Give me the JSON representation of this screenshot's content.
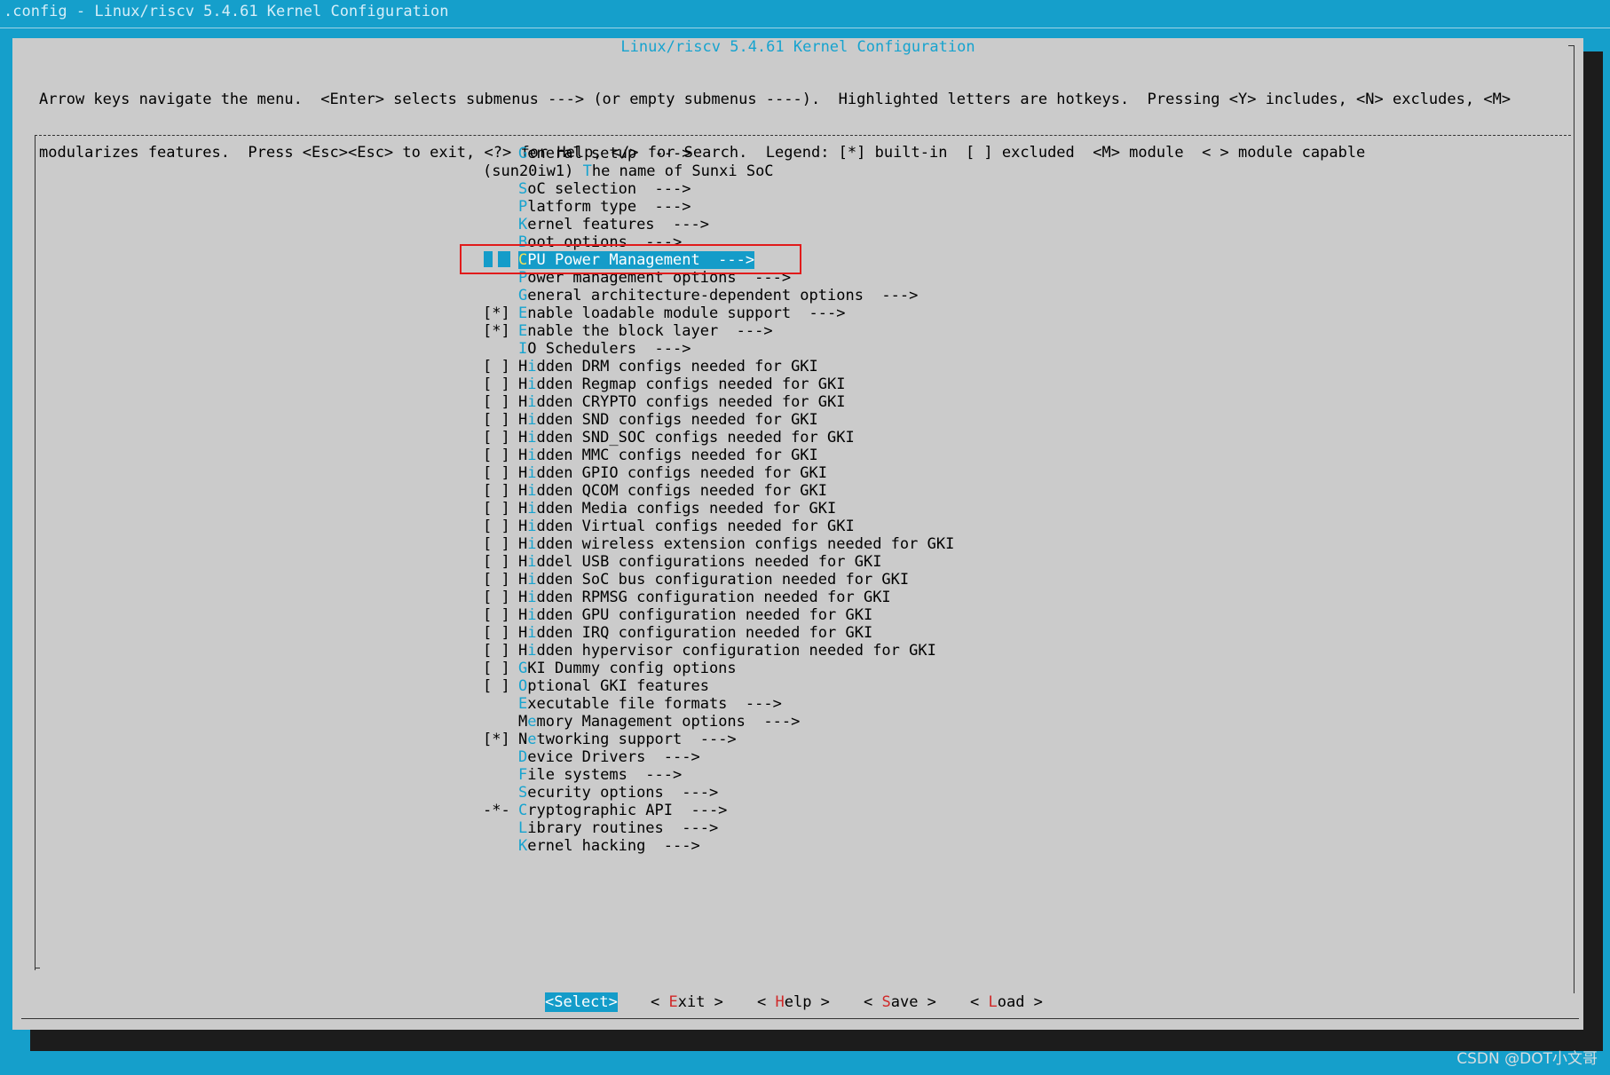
{
  "window": {
    "title": ".config - Linux/riscv 5.4.61 Kernel Configuration"
  },
  "dialog": {
    "title": "Linux/riscv 5.4.61 Kernel Configuration",
    "help_line1": "Arrow keys navigate the menu.  <Enter> selects submenus ---> (or empty submenus ----).  Highlighted letters are hotkeys.  Pressing <Y> includes, <N> excludes, <M>",
    "help_line2": "modularizes features.  Press <Esc><Esc> to exit, <?> for Help, </> for Search.  Legend: [*] built-in  [ ] excluded  <M> module  < > module capable"
  },
  "menu": {
    "selected_index": 6,
    "items": [
      {
        "prefix": "",
        "hotkey": "G",
        "rest": "eneral setup  --->"
      },
      {
        "prefix": "(sun20iw1) ",
        "hotkey": "T",
        "rest": "he name of Sunxi SoC",
        "inline": true
      },
      {
        "prefix": "",
        "hotkey": "S",
        "rest": "oC selection  --->"
      },
      {
        "prefix": "",
        "hotkey": "P",
        "rest": "latform type  --->"
      },
      {
        "prefix": "",
        "hotkey": "K",
        "rest": "ernel features  --->"
      },
      {
        "prefix": "",
        "hotkey": "B",
        "rest": "oot options  --->"
      },
      {
        "prefix": "",
        "hotkey": "C",
        "rest": "PU Power Management  --->"
      },
      {
        "prefix": "",
        "hotkey": "P",
        "rest": "ower management options  --->"
      },
      {
        "prefix": "",
        "hotkey": "G",
        "rest": "eneral architecture-dependent options  --->"
      },
      {
        "prefix": "[*]",
        "hotkey": "E",
        "rest": "nable loadable module support  --->"
      },
      {
        "prefix": "[*]",
        "hotkey": "E",
        "rest": "nable the block layer  --->"
      },
      {
        "prefix": "",
        "hotkey": "I",
        "rest": "O Schedulers  --->"
      },
      {
        "prefix": "[ ]",
        "lead": "H",
        "hotkey": "i",
        "rest": "dden DRM configs needed for GKI"
      },
      {
        "prefix": "[ ]",
        "lead": "H",
        "hotkey": "i",
        "rest": "dden Regmap configs needed for GKI"
      },
      {
        "prefix": "[ ]",
        "lead": "H",
        "hotkey": "i",
        "rest": "dden CRYPTO configs needed for GKI"
      },
      {
        "prefix": "[ ]",
        "lead": "H",
        "hotkey": "i",
        "rest": "dden SND configs needed for GKI"
      },
      {
        "prefix": "[ ]",
        "lead": "H",
        "hotkey": "i",
        "rest": "dden SND_SOC configs needed for GKI"
      },
      {
        "prefix": "[ ]",
        "lead": "H",
        "hotkey": "i",
        "rest": "dden MMC configs needed for GKI"
      },
      {
        "prefix": "[ ]",
        "lead": "H",
        "hotkey": "i",
        "rest": "dden GPIO configs needed for GKI"
      },
      {
        "prefix": "[ ]",
        "lead": "H",
        "hotkey": "i",
        "rest": "dden QCOM configs needed for GKI"
      },
      {
        "prefix": "[ ]",
        "lead": "H",
        "hotkey": "i",
        "rest": "dden Media configs needed for GKI"
      },
      {
        "prefix": "[ ]",
        "lead": "H",
        "hotkey": "i",
        "rest": "dden Virtual configs needed for GKI"
      },
      {
        "prefix": "[ ]",
        "lead": "H",
        "hotkey": "i",
        "rest": "dden wireless extension configs needed for GKI"
      },
      {
        "prefix": "[ ]",
        "lead": "H",
        "hotkey": "i",
        "rest": "ddel USB configurations needed for GKI"
      },
      {
        "prefix": "[ ]",
        "lead": "H",
        "hotkey": "i",
        "rest": "dden SoC bus configuration needed for GKI"
      },
      {
        "prefix": "[ ]",
        "lead": "H",
        "hotkey": "i",
        "rest": "dden RPMSG configuration needed for GKI"
      },
      {
        "prefix": "[ ]",
        "lead": "H",
        "hotkey": "i",
        "rest": "dden GPU configuration needed for GKI"
      },
      {
        "prefix": "[ ]",
        "lead": "H",
        "hotkey": "i",
        "rest": "dden IRQ configuration needed for GKI"
      },
      {
        "prefix": "[ ]",
        "lead": "H",
        "hotkey": "i",
        "rest": "dden hypervisor configuration needed for GKI"
      },
      {
        "prefix": "[ ]",
        "hotkey": "G",
        "rest": "KI Dummy config options"
      },
      {
        "prefix": "[ ]",
        "hotkey": "O",
        "rest": "ptional GKI features"
      },
      {
        "prefix": "",
        "hotkey": "E",
        "rest": "xecutable file formats  --->"
      },
      {
        "prefix": "",
        "lead": "M",
        "hotkey": "e",
        "rest": "mory Management options  --->"
      },
      {
        "prefix": "[*]",
        "lead": "N",
        "hotkey": "e",
        "rest": "tworking support  --->"
      },
      {
        "prefix": "",
        "hotkey": "D",
        "rest": "evice Drivers  --->"
      },
      {
        "prefix": "",
        "hotkey": "F",
        "rest": "ile systems  --->"
      },
      {
        "prefix": "",
        "hotkey": "S",
        "rest": "ecurity options  --->"
      },
      {
        "prefix": "-*-",
        "hotkey": "C",
        "rest": "ryptographic API  --->"
      },
      {
        "prefix": "",
        "hotkey": "L",
        "rest": "ibrary routines  --->"
      },
      {
        "prefix": "",
        "hotkey": "K",
        "rest": "ernel hacking  --->"
      }
    ]
  },
  "buttons": {
    "select": "<Select>",
    "exit": {
      "pre": "< ",
      "hotkey": "E",
      "rest": "xit >"
    },
    "help": {
      "pre": "< ",
      "hotkey": "H",
      "rest": "elp >"
    },
    "save": {
      "pre": "< ",
      "hotkey": "S",
      "rest": "ave >"
    },
    "load": {
      "pre": "< ",
      "hotkey": "L",
      "rest": "oad >"
    }
  },
  "watermark": "CSDN @DOT小文哥",
  "colors": {
    "background": "#159fcb",
    "dialog": "#cbcbcb",
    "hotkey": "#16a3cf",
    "selection": "#149cc9",
    "selected_hotkey": "#f3e05a",
    "button_hotkey": "#d02828",
    "annotation_box": "#e11b1b"
  }
}
